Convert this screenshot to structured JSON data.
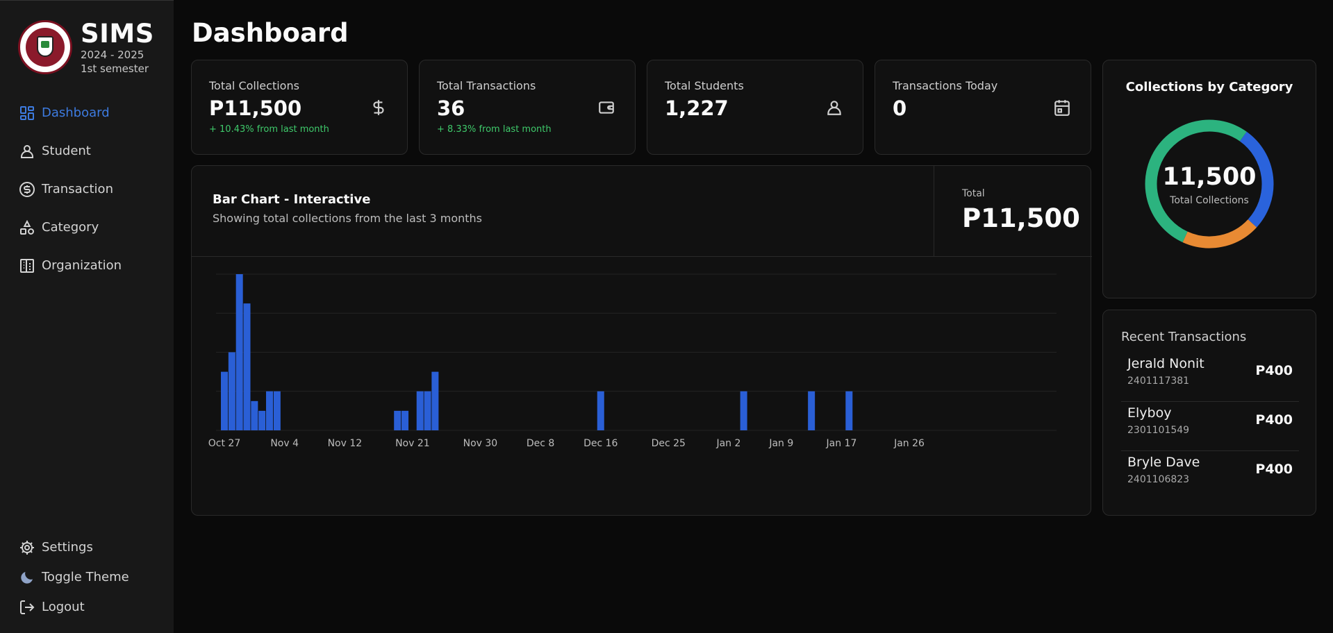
{
  "brand": {
    "title": "SIMS",
    "year": "2024 - 2025",
    "semester": "1st semester"
  },
  "nav": [
    {
      "label": "Dashboard",
      "icon": "dashboard-icon",
      "active": true
    },
    {
      "label": "Student",
      "icon": "user-icon"
    },
    {
      "label": "Transaction",
      "icon": "dollar-circle-icon"
    },
    {
      "label": "Category",
      "icon": "shapes-icon"
    },
    {
      "label": "Organization",
      "icon": "building-icon"
    }
  ],
  "nav_bottom": [
    {
      "label": "Settings",
      "icon": "gear-icon"
    },
    {
      "label": "Toggle Theme",
      "icon": "moon-icon"
    },
    {
      "label": "Logout",
      "icon": "logout-icon"
    }
  ],
  "page_title": "Dashboard",
  "stats": [
    {
      "label": "Total Collections",
      "value": "P11,500",
      "change": "+ 10.43% from last month",
      "icon": "dollar-icon"
    },
    {
      "label": "Total Transactions",
      "value": "36",
      "change": "+ 8.33% from last month",
      "icon": "wallet-icon"
    },
    {
      "label": "Total Students",
      "value": "1,227",
      "change": "",
      "icon": "user-icon"
    },
    {
      "label": "Transactions Today",
      "value": "0",
      "change": "",
      "icon": "calendar-icon"
    }
  ],
  "bar_chart": {
    "title": "Bar Chart - Interactive",
    "subtitle": "Showing total collections from the last 3 months",
    "total_label": "Total",
    "total_value": "P11,500"
  },
  "donut": {
    "title": "Collections by Category",
    "value": "11,500",
    "label": "Total Collections"
  },
  "recent": {
    "title": "Recent Transactions",
    "items": [
      {
        "name": "Jerald Nonit",
        "id": "2401117381",
        "amount": "P400"
      },
      {
        "name": "Elyboy",
        "id": "2301101549",
        "amount": "P400"
      },
      {
        "name": "Bryle Dave",
        "id": "2401106823",
        "amount": "P400"
      }
    ]
  },
  "colors": {
    "accent": "#3d7be0",
    "bar": "#2a5fd6",
    "positive": "#3fca6b",
    "donut_blue": "#2a63dc",
    "donut_orange": "#e88a33",
    "donut_green": "#2cb37f"
  },
  "chart_data": [
    {
      "type": "bar",
      "x_tick_labels": [
        "Oct 27",
        "Nov 4",
        "Nov 12",
        "Nov 21",
        "Nov 30",
        "Dec 8",
        "Dec 16",
        "Dec 25",
        "Jan 2",
        "Jan 9",
        "Jan 17",
        "Jan 26"
      ],
      "x": [
        "Oct 27",
        "Oct 28",
        "Oct 29",
        "Oct 30",
        "Oct 31",
        "Nov 1",
        "Nov 2",
        "Nov 3",
        "Nov 19",
        "Nov 20",
        "Nov 22",
        "Nov 23",
        "Nov 24",
        "Dec 16",
        "Jan 4",
        "Jan 13",
        "Jan 18"
      ],
      "values": [
        1500,
        2000,
        4000,
        3250,
        750,
        500,
        1000,
        1000,
        500,
        500,
        1000,
        1000,
        1500,
        1000,
        1000,
        1000,
        1000
      ],
      "ylim": [
        0,
        4000
      ],
      "grid": true
    },
    {
      "type": "pie",
      "labels": [
        "",
        "",
        ""
      ],
      "values": [
        3100,
        2300,
        6100
      ]
    }
  ]
}
